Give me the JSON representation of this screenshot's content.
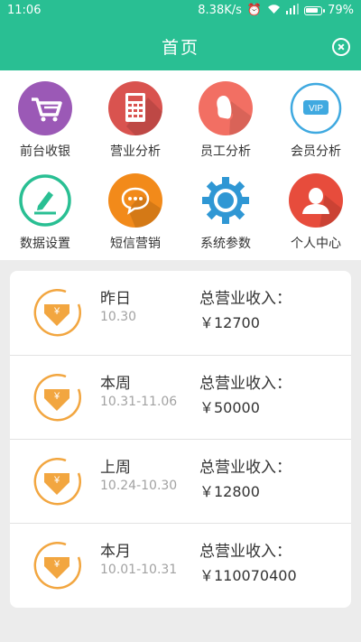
{
  "status_bar": {
    "time": "11:06",
    "network_speed": "8.38K/s",
    "battery_percent": "79%"
  },
  "header": {
    "title": "首页"
  },
  "menu": {
    "items": [
      {
        "label": "前台收银",
        "icon": "shopping-cart-icon",
        "color": "#9b59b6"
      },
      {
        "label": "营业分析",
        "icon": "calculator-icon",
        "color": "#d9534f"
      },
      {
        "label": "员工分析",
        "icon": "staff-icon",
        "color": "#f26f63"
      },
      {
        "label": "会员分析",
        "icon": "vip-icon",
        "color": "#3fa9e0"
      },
      {
        "label": "数据设置",
        "icon": "edit-icon",
        "color": "#29bf93"
      },
      {
        "label": "短信营销",
        "icon": "message-icon",
        "color": "#f28a1a"
      },
      {
        "label": "系统参数",
        "icon": "gear-icon",
        "color": "#2f97d4"
      },
      {
        "label": "个人中心",
        "icon": "user-icon",
        "color": "#e74c3c"
      }
    ]
  },
  "revenue": {
    "label": "总营业收入：",
    "rows": [
      {
        "period": "昨日",
        "range": "10.30",
        "amount": "￥12700"
      },
      {
        "period": "本周",
        "range": "10.31-11.06",
        "amount": "￥50000"
      },
      {
        "period": "上周",
        "range": "10.24-10.30",
        "amount": "￥12800"
      },
      {
        "period": "本月",
        "range": "10.01-10.31",
        "amount": "￥110070400"
      }
    ]
  },
  "colors": {
    "brand": "#29bf93",
    "coin": "#f2a640"
  }
}
